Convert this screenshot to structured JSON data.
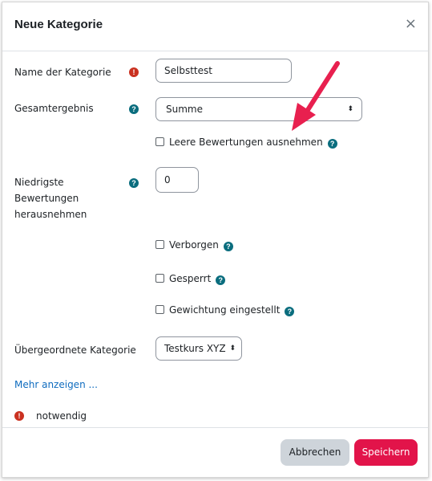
{
  "dialog": {
    "title": "Neue Kategorie",
    "close_symbol": "×"
  },
  "fields": {
    "name": {
      "label": "Name der Kategorie",
      "value": "Selbsttest",
      "required_symbol": "!"
    },
    "aggregation": {
      "label": "Gesamtergebnis",
      "selected": "Summe",
      "help_symbol": "?"
    },
    "exclude_empty": {
      "label": "Leere Bewertungen ausnehmen",
      "checked": false
    },
    "drop_lowest": {
      "label_line1": "Niedrigste",
      "label_line2": "Bewertungen",
      "label_line3": "herausnehmen",
      "value": "0"
    },
    "hidden": {
      "label": "Verborgen",
      "checked": false
    },
    "locked": {
      "label": "Gesperrt",
      "checked": false
    },
    "weight_adjusted": {
      "label": "Gewichtung eingestellt",
      "checked": false
    },
    "parent_category": {
      "label": "Übergeordnete Kategorie",
      "selected": "Testkurs XYZ"
    }
  },
  "show_more": "Mehr anzeigen ...",
  "required_note": "notwendig",
  "buttons": {
    "cancel": "Abbrechen",
    "save": "Speichern"
  },
  "colors": {
    "required": "#ca3120",
    "help": "#0a6d7e",
    "primary": "#e2144a",
    "secondary": "#ced4da",
    "link": "#0f6cbf",
    "annotation_arrow": "#e8204f"
  }
}
